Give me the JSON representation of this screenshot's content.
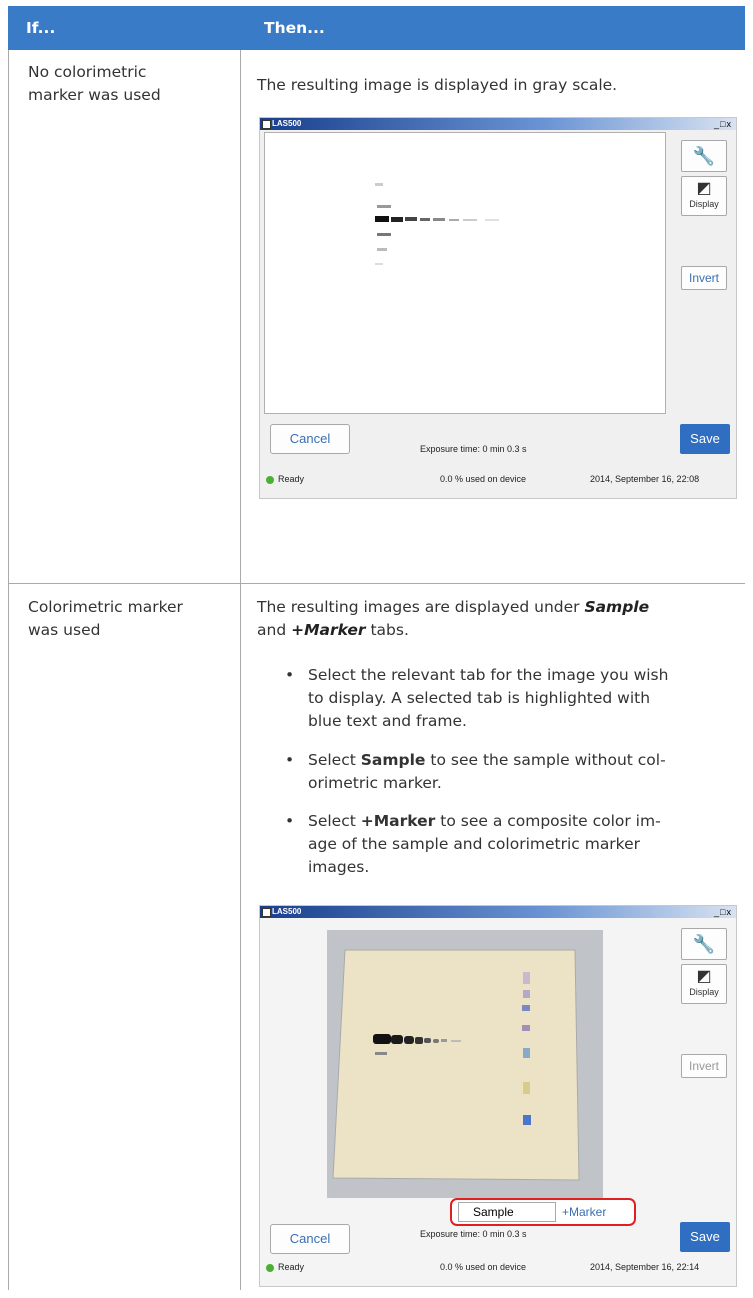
{
  "table": {
    "col_if": "If...",
    "col_then": "Then..."
  },
  "row1": {
    "condition_line1": "No colorimetric",
    "condition_line2": "marker was used",
    "result": "The resulting image is displayed in gray scale."
  },
  "row2": {
    "condition_line1": "Colorimetric marker",
    "condition_line2": "was used",
    "intro_pre": "The resulting images are displayed under ",
    "intro_sample": "Sample",
    "intro_and": "and ",
    "intro_marker": "+Marker",
    "intro_post": " tabs.",
    "bullet1_l1": "Select the relevant tab for the image you wish",
    "bullet1_l2": "to display. A selected tab is highlighted with",
    "bullet1_l3": "blue text and frame.",
    "bullet2_pre": "Select ",
    "bullet2_em": "Sample",
    "bullet2_l1_post": " to see the sample without col-",
    "bullet2_l2": "orimetric marker.",
    "bullet3_pre": "Select ",
    "bullet3_em": "+Marker",
    "bullet3_l1_post": " to see a composite color im-",
    "bullet3_l2": "age of the sample and colorimetric marker",
    "bullet3_l3": "images."
  },
  "window1": {
    "title": "LAS500",
    "controls": "_□x",
    "display_label": "Display",
    "invert_label": "Invert",
    "cancel_label": "Cancel",
    "save_label": "Save",
    "exposure": "Exposure time: 0 min 0.3 s",
    "status": "Ready",
    "used": "0.0 % used on device",
    "datetime": "2014, September 16, 22:08"
  },
  "window2": {
    "title": "LAS500",
    "controls": "_□x",
    "display_label": "Display",
    "invert_label": "Invert",
    "tab_sample": "Sample",
    "tab_marker": "+Marker",
    "cancel_label": "Cancel",
    "save_label": "Save",
    "exposure": "Exposure time: 0 min 0.3 s",
    "status": "Ready",
    "used": "0.0 % used on device",
    "datetime": "2014, September 16, 22:14"
  },
  "colors": {
    "header_bg": "#3a7bc8",
    "save_bg": "#2f6ec0",
    "tab_highlight": "#e02020"
  }
}
